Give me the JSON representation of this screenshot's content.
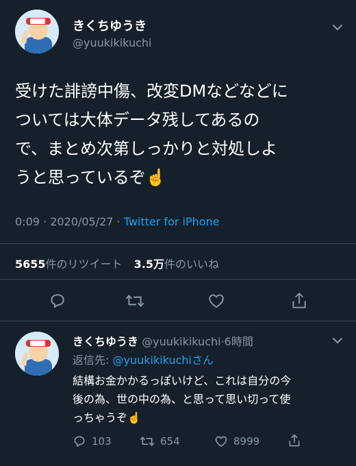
{
  "main_tweet": {
    "display_name": "きくちゆうき",
    "handle": "@yuukikikuchi",
    "text_lines": [
      "受けた誹謗中傷、改変DMなどなどに",
      "ついては大体データ残してあるの",
      "で、まとめ次第しっかりと対処しよ",
      "うと思っているぞ☝️"
    ],
    "time": "0:09",
    "date": "2020/05/27",
    "separator": "·",
    "source": "Twitter for iPhone",
    "retweets_count": "5655",
    "retweets_label": "件のリツイート",
    "likes_count": "3.5万",
    "likes_label": "件のいいね"
  },
  "reply_tweet": {
    "display_name": "きくちゆうき",
    "handle": "@yuukikikuchi",
    "time_ago": "6時間",
    "separator": "·",
    "replying_to_label": "返信先: ",
    "replying_to_handle": "@yuukikikuchi",
    "replying_to_suffix": "さん",
    "text_lines": [
      "結構お金かかるっぽいけど、これは自分の今",
      "後の為、世の中の為、と思って思い切って使",
      "っちゃうぞ☝️"
    ],
    "reply_count": "103",
    "retweet_count": "654",
    "like_count": "8999"
  },
  "colors": {
    "background": "#15202b",
    "text": "#ffffff",
    "muted": "#8899a6",
    "link": "#1da1f2",
    "divider": "#38444d"
  }
}
